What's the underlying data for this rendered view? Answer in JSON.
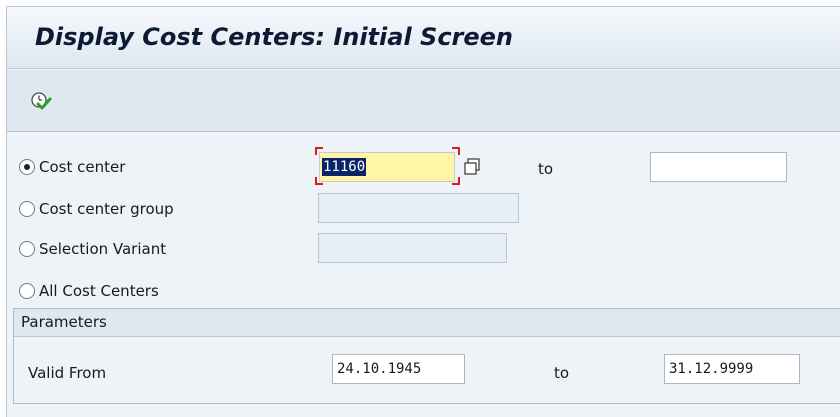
{
  "window": {
    "title": "Display Cost Centers: Initial Screen"
  },
  "toolbar": {
    "execute_icon": "execute-clock-check-icon"
  },
  "selection": {
    "options": [
      {
        "label": "Cost center",
        "checked": true
      },
      {
        "label": "Cost center group",
        "checked": false
      },
      {
        "label": "Selection Variant",
        "checked": false
      },
      {
        "label": "All Cost Centers",
        "checked": false
      }
    ],
    "cost_center_from": "11160",
    "cost_center_to_label": "to",
    "cost_center_to": "",
    "cost_center_group": "",
    "selection_variant": "",
    "multiple_selection_icon": "multiple-selection-icon"
  },
  "parameters": {
    "header": "Parameters",
    "valid_from_label": "Valid From",
    "valid_from": "24.10.1945",
    "to_label": "to",
    "valid_to": "31.12.9999"
  },
  "colors": {
    "focus_field": "#fff5a6",
    "focus_frame": "#e21818",
    "selection_highlight": "#0a246a",
    "background": "#eef3f8"
  }
}
